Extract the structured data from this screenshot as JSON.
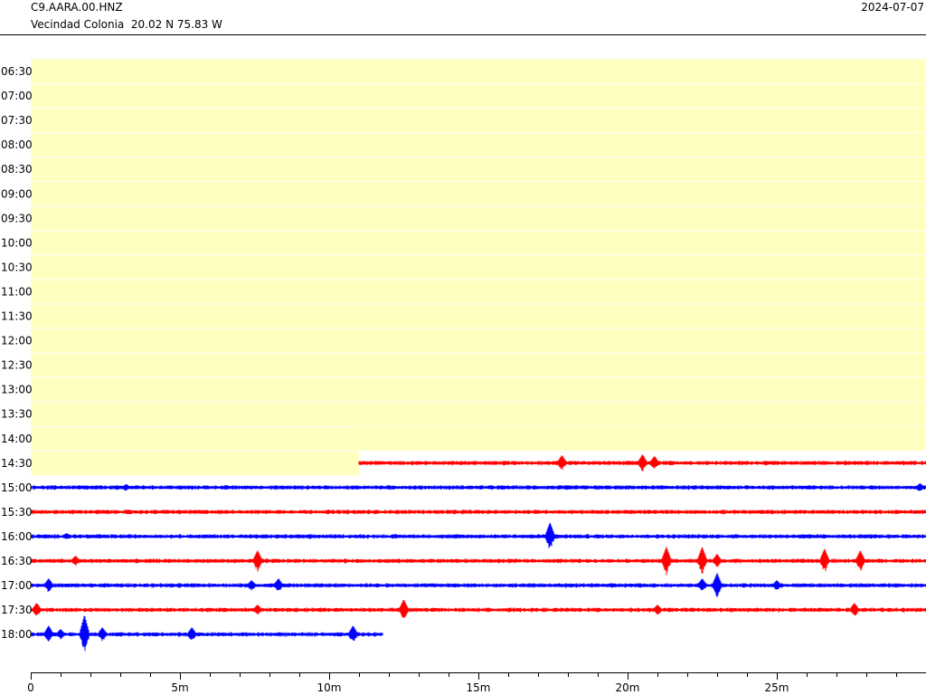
{
  "header": {
    "station": "C9.AARA.00.HNZ",
    "location": "Vecindad Colonia  20.02 N 75.83 W",
    "date": "2024-07-07"
  },
  "colors": {
    "nodata_fill": "#ffffc0",
    "trace_a": "#ff0000",
    "trace_b": "#0000ff",
    "axis": "#000000"
  },
  "rows": [
    {
      "label": "06:30",
      "type": "nodata"
    },
    {
      "label": "07:00",
      "type": "nodata"
    },
    {
      "label": "07:30",
      "type": "nodata"
    },
    {
      "label": "08:00",
      "type": "nodata"
    },
    {
      "label": "08:30",
      "type": "nodata"
    },
    {
      "label": "09:00",
      "type": "nodata"
    },
    {
      "label": "09:30",
      "type": "nodata"
    },
    {
      "label": "10:00",
      "type": "nodata"
    },
    {
      "label": "10:30",
      "type": "nodata"
    },
    {
      "label": "11:00",
      "type": "nodata"
    },
    {
      "label": "11:30",
      "type": "nodata"
    },
    {
      "label": "12:00",
      "type": "nodata"
    },
    {
      "label": "12:30",
      "type": "nodata"
    },
    {
      "label": "13:00",
      "type": "nodata"
    },
    {
      "label": "13:30",
      "type": "nodata"
    },
    {
      "label": "14:00",
      "type": "nodata"
    },
    {
      "label": "14:30",
      "type": "partial",
      "color": "red",
      "nodata_until_min": 11.0,
      "data_from_min": 11.0,
      "data_to_min": 30,
      "events": [
        [
          17.8,
          9
        ],
        [
          20.5,
          10
        ],
        [
          20.9,
          8
        ]
      ]
    },
    {
      "label": "15:00",
      "type": "trace",
      "color": "blue",
      "data_from_min": 0,
      "data_to_min": 30,
      "events": [
        [
          3.2,
          4
        ],
        [
          29.8,
          5
        ]
      ]
    },
    {
      "label": "15:30",
      "type": "trace",
      "color": "red",
      "data_from_min": 0,
      "data_to_min": 30,
      "events": []
    },
    {
      "label": "16:00",
      "type": "trace",
      "color": "blue",
      "data_from_min": 0,
      "data_to_min": 30,
      "events": [
        [
          17.4,
          16
        ],
        [
          1.2,
          4
        ]
      ]
    },
    {
      "label": "16:30",
      "type": "trace",
      "color": "red",
      "data_from_min": 0,
      "data_to_min": 30,
      "events": [
        [
          1.5,
          6
        ],
        [
          7.6,
          12
        ],
        [
          21.3,
          16
        ],
        [
          22.5,
          16
        ],
        [
          23.0,
          8
        ],
        [
          26.6,
          14
        ],
        [
          27.8,
          12
        ]
      ]
    },
    {
      "label": "17:00",
      "type": "trace",
      "color": "blue",
      "data_from_min": 0,
      "data_to_min": 30,
      "events": [
        [
          0.6,
          8
        ],
        [
          7.4,
          6
        ],
        [
          8.3,
          8
        ],
        [
          22.5,
          8
        ],
        [
          23.0,
          14
        ],
        [
          25.0,
          6
        ]
      ]
    },
    {
      "label": "17:30",
      "type": "trace",
      "color": "red",
      "data_from_min": 0,
      "data_to_min": 30,
      "events": [
        [
          0.2,
          8
        ],
        [
          7.6,
          6
        ],
        [
          12.5,
          12
        ],
        [
          21.0,
          6
        ],
        [
          27.6,
          8
        ]
      ]
    },
    {
      "label": "18:00",
      "type": "trace",
      "color": "blue",
      "data_from_min": 0,
      "data_to_min": 11.8,
      "events": [
        [
          0.6,
          10
        ],
        [
          1.0,
          6
        ],
        [
          1.8,
          22
        ],
        [
          2.4,
          8
        ],
        [
          5.4,
          8
        ],
        [
          10.8,
          10
        ]
      ]
    }
  ],
  "x_axis": {
    "max_min": 30,
    "labels": [
      {
        "min": 0,
        "text": "0"
      },
      {
        "min": 5,
        "text": "5m"
      },
      {
        "min": 10,
        "text": "10m"
      },
      {
        "min": 15,
        "text": "15m"
      },
      {
        "min": 20,
        "text": "20m"
      },
      {
        "min": 25,
        "text": "25m"
      }
    ]
  }
}
